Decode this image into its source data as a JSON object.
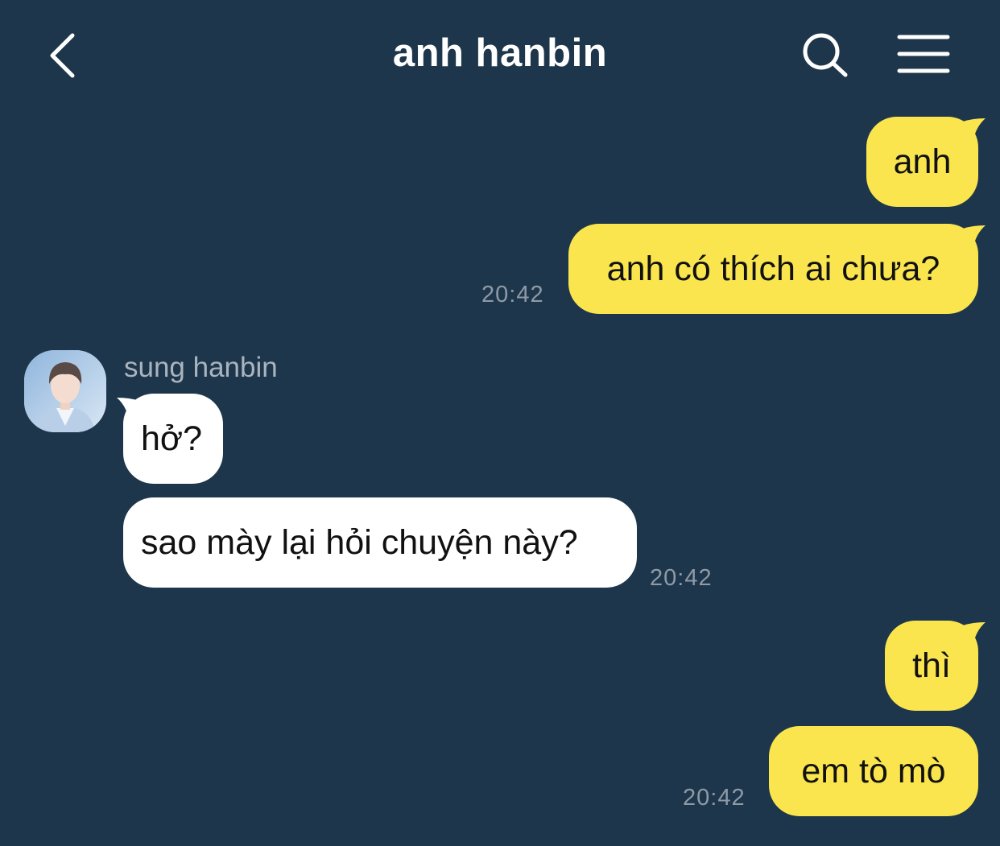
{
  "header": {
    "title": "anh hanbin",
    "back_icon": "chevron-left-icon",
    "search_icon": "search-icon",
    "menu_icon": "menu-icon"
  },
  "colors": {
    "background": "#1e364b",
    "my_bubble": "#fae54f",
    "their_bubble": "#ffffff",
    "timestamp": "#8e9aa6"
  },
  "conversation": {
    "outgoing_1": [
      "anh",
      "anh có thích ai chưa?"
    ],
    "outgoing_1_time": "20:42",
    "incoming_sender": "sung hanbin",
    "incoming": [
      "hở?",
      "sao mày lại hỏi chuyện này?"
    ],
    "incoming_time": "20:42",
    "outgoing_2": [
      "thì",
      "em tò mò"
    ],
    "outgoing_2_time": "20:42"
  }
}
